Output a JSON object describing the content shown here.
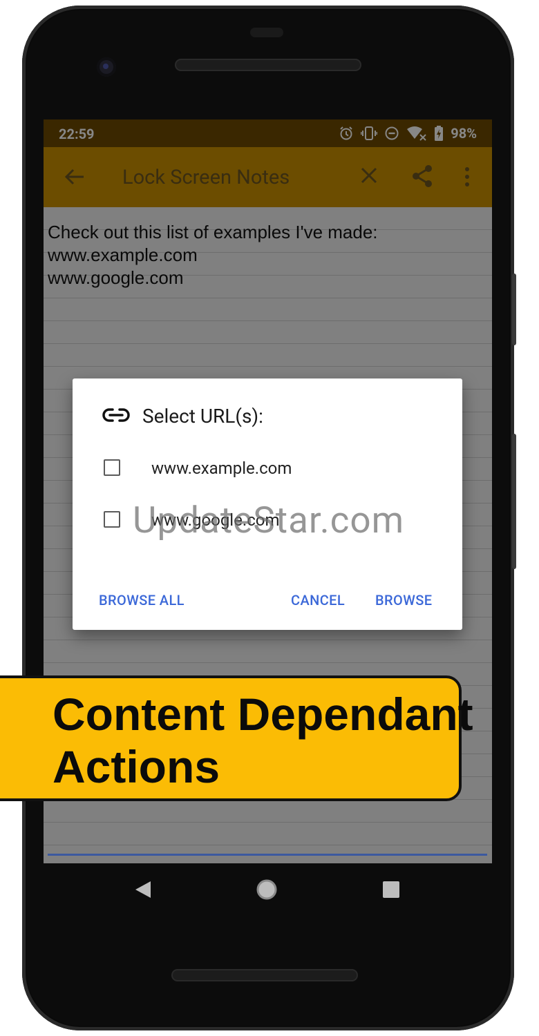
{
  "status_bar": {
    "time": "22:59",
    "battery": "98%"
  },
  "app_bar": {
    "title": "Lock Screen Notes"
  },
  "note": {
    "text": "Check out this list of examples I've made:\nwww.example.com\nwww.google.com"
  },
  "dialog": {
    "title": "Select URL(s):",
    "items": [
      {
        "label": "www.example.com",
        "checked": false
      },
      {
        "label": "www.google.com",
        "checked": false
      }
    ],
    "buttons": {
      "browse_all": "BROWSE ALL",
      "cancel": "CANCEL",
      "browse": "BROWSE"
    }
  },
  "watermark": "UpdateStar.com",
  "banner": {
    "text": "Content Dependant\nActions"
  },
  "colors": {
    "accent": "#3b68d8",
    "appbar": "#cc9200",
    "statusbar": "#6e4a00",
    "banner": "#fbbc05"
  }
}
